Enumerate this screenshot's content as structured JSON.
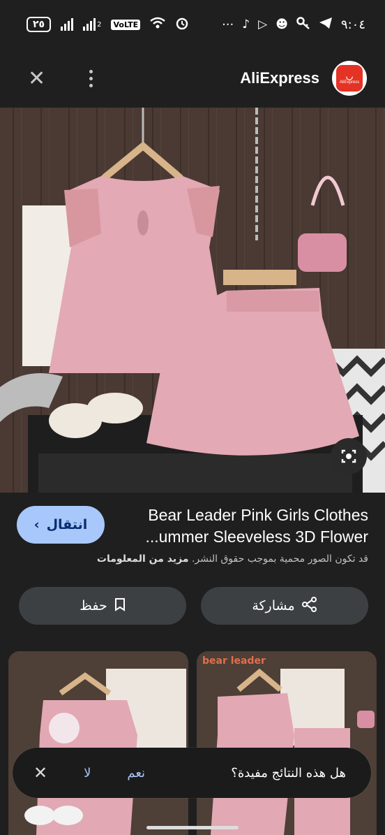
{
  "status_bar": {
    "battery": "٢٥",
    "volte": "VoLTE",
    "sim2": "2",
    "time": "٩:٠٤",
    "dots": "···"
  },
  "appbar": {
    "site_name": "AliExpress",
    "logo_text": "AliExpress"
  },
  "product": {
    "title_line1": "Bear Leader Pink Girls Clothes",
    "title_line2": "...ummer Sleeveless 3D Flower",
    "goto_label": "انتقال",
    "copyright_text": "قد تكون الصور محمية بموجب حقوق النشر.",
    "more_info": "مزيد من المعلومات"
  },
  "actions": {
    "share_label": "مشاركة",
    "save_label": "حفظ"
  },
  "thumbs": {
    "brand_watermark": "bear leader"
  },
  "feedback": {
    "question": "هل هذه النتائج مفيدة؟",
    "yes": "نعم",
    "no": "لا"
  },
  "colors": {
    "accent_button": "#a8c7fa",
    "pill_bg": "#3c4043",
    "brand_red": "#e43225"
  }
}
